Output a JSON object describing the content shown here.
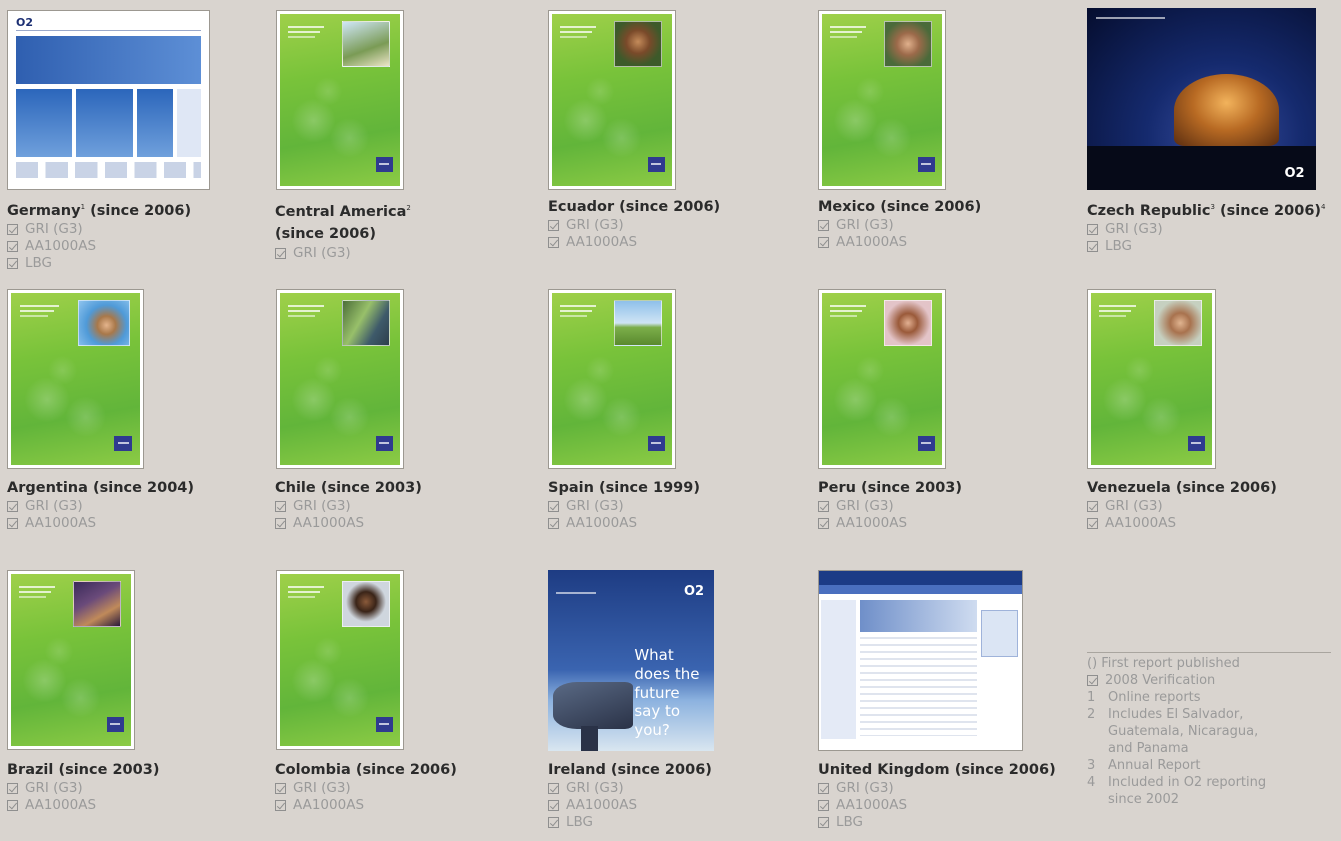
{
  "reports": [
    {
      "country": "Germany",
      "note": "1",
      "since": "(since 2006)",
      "checks": [
        "GRI (G3)",
        "AA1000AS",
        "LBG"
      ]
    },
    {
      "country": "Central America",
      "note": "2",
      "since": "(since 2006)",
      "checks": [
        "GRI (G3)"
      ]
    },
    {
      "country": "Ecuador",
      "note": "",
      "since": "(since 2006)",
      "checks": [
        "GRI (G3)",
        "AA1000AS"
      ]
    },
    {
      "country": "Mexico",
      "note": "",
      "since": "(since 2006)",
      "checks": [
        "GRI (G3)",
        "AA1000AS"
      ]
    },
    {
      "country": "Czech Republic",
      "note": "3",
      "since": "(since 2006)",
      "after_note": "4",
      "checks": [
        "GRI (G3)",
        "LBG"
      ]
    },
    {
      "country": "Argentina",
      "note": "",
      "since": "(since 2004)",
      "checks": [
        "GRI (G3)",
        "AA1000AS"
      ]
    },
    {
      "country": "Chile",
      "note": "",
      "since": "(since 2003)",
      "checks": [
        "GRI (G3)",
        "AA1000AS"
      ]
    },
    {
      "country": "Spain",
      "note": "",
      "since": "(since 1999)",
      "checks": [
        "GRI (G3)",
        "AA1000AS"
      ]
    },
    {
      "country": "Peru",
      "note": "",
      "since": "(since 2003)",
      "checks": [
        "GRI (G3)",
        "AA1000AS"
      ]
    },
    {
      "country": "Venezuela",
      "note": "",
      "since": "(since 2006)",
      "checks": [
        "GRI (G3)",
        "AA1000AS"
      ]
    },
    {
      "country": "Brazil",
      "note": "",
      "since": "(since 2003)",
      "checks": [
        "GRI (G3)",
        "AA1000AS"
      ]
    },
    {
      "country": "Colombia",
      "note": "",
      "since": "(since 2006)",
      "checks": [
        "GRI (G3)",
        "AA1000AS"
      ]
    },
    {
      "country": "Ireland",
      "note": "",
      "since": "(since 2006)",
      "checks": [
        "GRI (G3)",
        "AA1000AS",
        "LBG"
      ]
    },
    {
      "country": "United Kingdom",
      "note": "",
      "since": "(since 2006)",
      "checks": [
        "GRI (G3)",
        "AA1000AS",
        "LBG"
      ]
    }
  ],
  "covers": {
    "germany_brand": "O2",
    "czech_brand": "O2",
    "ireland_brand": "O2",
    "ireland_tagline": "What does the future say to you?"
  },
  "legend": {
    "first_report": "() First report published",
    "verification": "2008 Verification",
    "notes": [
      {
        "num": "1",
        "text": "Online reports"
      },
      {
        "num": "2",
        "text": "Includes El Salvador, Guatemala, Nicaragua, and Panama"
      },
      {
        "num": "3",
        "text": "Annual Report"
      },
      {
        "num": "4",
        "text": "Included in O2 reporting since 2002"
      }
    ]
  },
  "colors": {
    "background": "#d9d4cf",
    "title_text": "#2b2b2b",
    "check_text": "#9a9a9a",
    "cover_green": "#79c33a",
    "telefonica_blue": "#2f3a8f"
  }
}
